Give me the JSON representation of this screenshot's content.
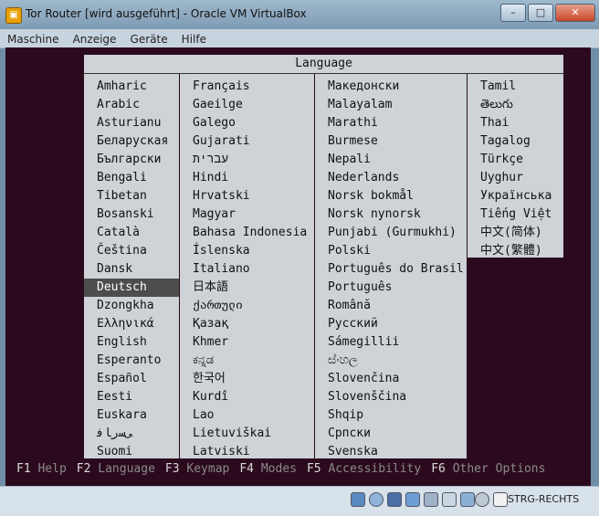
{
  "window": {
    "title": "Tor Router [wird ausgeführt] - Oracle VM VirtualBox",
    "buttons": {
      "minimize": "–",
      "maximize": "□",
      "close": "✕"
    }
  },
  "menu": [
    "Maschine",
    "Anzeige",
    "Geräte",
    "Hilfe"
  ],
  "screen": {
    "header": "Language",
    "columns": [
      [
        "Amharic",
        "Arabic",
        "Asturianu",
        "Беларуская",
        "Български",
        "Bengali",
        "Tibetan",
        "Bosanski",
        "Català",
        "Čeština",
        "Dansk",
        "Deutsch",
        "Dzongkha",
        "Ελληνικά",
        "English",
        "Esperanto",
        "Español",
        "Eesti",
        "Euskara",
        "ﻰﺳﺭﺎﻓ",
        "Suomi"
      ],
      [
        "Français",
        "Gaeilge",
        "Galego",
        "Gujarati",
        "עברית",
        "Hindi",
        "Hrvatski",
        "Magyar",
        "Bahasa Indonesia",
        "Íslenska",
        "Italiano",
        "日本語",
        "ქართული",
        "Қазақ",
        "Khmer",
        "ಕನ್ನಡ",
        "한국어",
        "Kurdî",
        "Lao",
        "Lietuviškai",
        "Latviski"
      ],
      [
        "Македонски",
        "Malayalam",
        "Marathi",
        "Burmese",
        "Nepali",
        "Nederlands",
        "Norsk bokmål",
        "Norsk nynorsk",
        "Punjabi (Gurmukhi)",
        "Polski",
        "Português do Brasil",
        "Português",
        "Română",
        "Русский",
        "Sámegillii",
        "ස්ංහල",
        "Slovenčina",
        "Slovenščina",
        "Shqip",
        "Српски",
        "Svenska"
      ],
      [
        "Tamil",
        "తెలుగు",
        "Thai",
        "Tagalog",
        "Türkçe",
        "Uyghur",
        "Українська",
        "Tiếng Việt",
        "中文(简体)",
        "中文(繁體)"
      ]
    ],
    "selected": "Deutsch",
    "fkeys": [
      {
        "key": "F1",
        "label": "Help"
      },
      {
        "key": "F2",
        "label": "Language"
      },
      {
        "key": "F3",
        "label": "Keymap"
      },
      {
        "key": "F4",
        "label": "Modes"
      },
      {
        "key": "F5",
        "label": "Accessibility"
      },
      {
        "key": "F6",
        "label": "Other Options"
      }
    ]
  },
  "statusbar": {
    "icons": [
      "hard-disk-icon",
      "optical-drive-icon",
      "usb-icon",
      "network-icon",
      "shared-folder-icon",
      "display-icon",
      "video-capture-icon",
      "mouse-integration-icon",
      "host-key-arrow-icon"
    ],
    "host_key": "STRG-RECHTS"
  }
}
